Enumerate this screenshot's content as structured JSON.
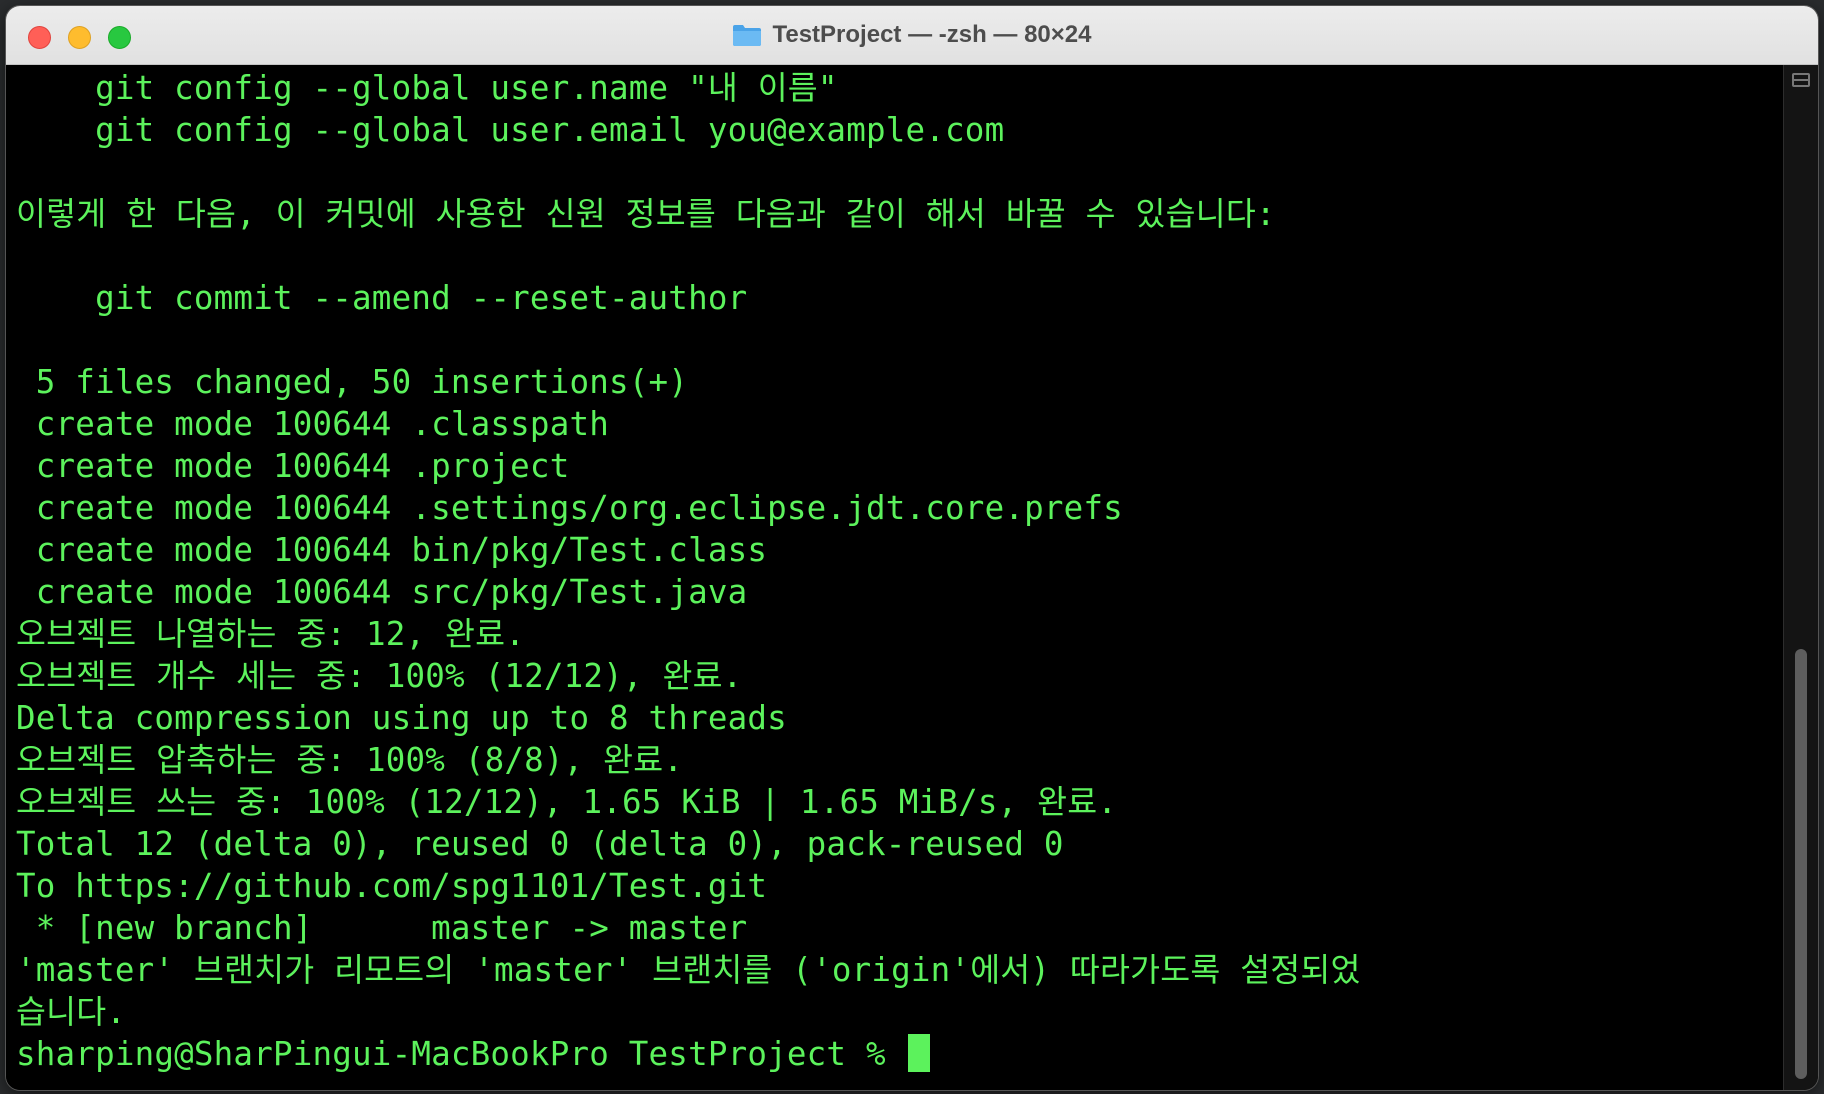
{
  "window": {
    "title": "TestProject — -zsh — 80×24"
  },
  "terminal": {
    "lines": [
      "    git config --global user.name \"내 이름\"",
      "    git config --global user.email you@example.com",
      "",
      "이렇게 한 다음, 이 커밋에 사용한 신원 정보를 다음과 같이 해서 바꿀 수 있습니다:",
      "",
      "    git commit --amend --reset-author",
      "",
      " 5 files changed, 50 insertions(+)",
      " create mode 100644 .classpath",
      " create mode 100644 .project",
      " create mode 100644 .settings/org.eclipse.jdt.core.prefs",
      " create mode 100644 bin/pkg/Test.class",
      " create mode 100644 src/pkg/Test.java",
      "오브젝트 나열하는 중: 12, 완료.",
      "오브젝트 개수 세는 중: 100% (12/12), 완료.",
      "Delta compression using up to 8 threads",
      "오브젝트 압축하는 중: 100% (8/8), 완료.",
      "오브젝트 쓰는 중: 100% (12/12), 1.65 KiB | 1.65 MiB/s, 완료.",
      "Total 12 (delta 0), reused 0 (delta 0), pack-reused 0",
      "To https://github.com/spg1101/Test.git",
      " * [new branch]      master -> master",
      "'master' 브랜치가 리모트의 'master' 브랜치를 ('origin'에서) 따라가도록 설정되었",
      "습니다."
    ],
    "prompt": "sharping@SharPingui-MacBookPro TestProject % ",
    "text_color": "#5cf25c",
    "background_color": "#000000"
  }
}
